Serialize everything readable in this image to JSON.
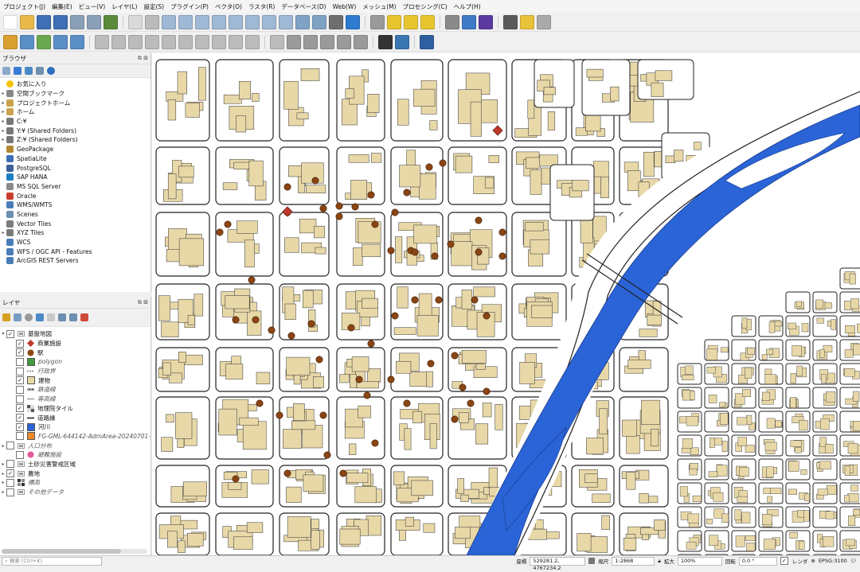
{
  "menu": [
    "プロジェクト(J)",
    "編集(E)",
    "ビュー(V)",
    "レイヤ(L)",
    "設定(S)",
    "プラグイン(P)",
    "ベクタ(O)",
    "ラスタ(R)",
    "データベース(D)",
    "Web(W)",
    "メッシュ(M)",
    "プロセシング(C)",
    "ヘルプ(H)"
  ],
  "browser": {
    "title": "ブラウザ",
    "items": [
      {
        "label": "お気に入り",
        "icon": "star-icon",
        "color": "#f5c400",
        "arrow": ""
      },
      {
        "label": "空間ブックマーク",
        "icon": "bookmark-icon",
        "color": "#888888",
        "arrow": "▸"
      },
      {
        "label": "プロジェクトホーム",
        "icon": "folder-icon",
        "color": "#c9a24c",
        "arrow": "▸"
      },
      {
        "label": "ホーム",
        "icon": "folder-icon",
        "color": "#c9a24c",
        "arrow": "▸"
      },
      {
        "label": "C:¥",
        "icon": "drive-icon",
        "color": "#777777",
        "arrow": "▸"
      },
      {
        "label": "Y:¥ (Shared Folders)",
        "icon": "drive-icon",
        "color": "#777777",
        "arrow": "▸"
      },
      {
        "label": "Z:¥ (Shared Folders)",
        "icon": "drive-icon",
        "color": "#777777",
        "arrow": "▸"
      },
      {
        "label": "GeoPackage",
        "icon": "geopackage-icon",
        "color": "#b0892f",
        "arrow": ""
      },
      {
        "label": "SpatiaLite",
        "icon": "spatialite-icon",
        "color": "#3d6fb6",
        "arrow": ""
      },
      {
        "label": "PostgreSQL",
        "icon": "postgresql-icon",
        "color": "#3b5f9a",
        "arrow": ""
      },
      {
        "label": "SAP HANA",
        "icon": "sap-hana-icon",
        "color": "#1c7fc4",
        "arrow": ""
      },
      {
        "label": "MS SQL Server",
        "icon": "mssql-icon",
        "color": "#8a8a8a",
        "arrow": ""
      },
      {
        "label": "Oracle",
        "icon": "oracle-icon",
        "color": "#c8402e",
        "arrow": ""
      },
      {
        "label": "WMS/WMTS",
        "icon": "globe-icon",
        "color": "#4a7db8",
        "arrow": ""
      },
      {
        "label": "Scenes",
        "icon": "scenes-icon",
        "color": "#6a8fb0",
        "arrow": ""
      },
      {
        "label": "Vector Tiles",
        "icon": "grid-icon",
        "color": "#7a7a7a",
        "arrow": ""
      },
      {
        "label": "XYZ Tiles",
        "icon": "grid-icon",
        "color": "#7a7a7a",
        "arrow": "▸"
      },
      {
        "label": "WCS",
        "icon": "globe-icon",
        "color": "#4a7db8",
        "arrow": ""
      },
      {
        "label": "WFS / OGC API - Features",
        "icon": "globe-icon",
        "color": "#4a7db8",
        "arrow": ""
      },
      {
        "label": "ArcGIS REST Servers",
        "icon": "globe-icon",
        "color": "#4a7db8",
        "arrow": ""
      }
    ]
  },
  "layers": {
    "title": "レイヤ",
    "items": [
      {
        "label": "基盤地図",
        "level": 0,
        "checked": true,
        "arrow": "▾",
        "icon": "group-icon",
        "symbol": "group",
        "color": "#999999",
        "italic": false
      },
      {
        "label": "商業施設",
        "level": 1,
        "checked": true,
        "arrow": "",
        "icon": "diamond-icon",
        "symbol": "diamond",
        "color": "#c0392b",
        "italic": false
      },
      {
        "label": "駅",
        "level": 1,
        "checked": true,
        "arrow": "",
        "icon": "circle-icon",
        "symbol": "circle",
        "color": "#8b4513",
        "italic": false
      },
      {
        "label": "polygon",
        "level": 1,
        "checked": false,
        "arrow": "",
        "icon": "square-icon",
        "symbol": "square",
        "color": "#3f9a3f",
        "italic": true
      },
      {
        "label": "行政界",
        "level": 1,
        "checked": false,
        "arrow": "",
        "icon": "dash-line-icon",
        "symbol": "dash",
        "color": "#555555",
        "italic": true
      },
      {
        "label": "建物",
        "level": 1,
        "checked": true,
        "arrow": "",
        "icon": "square-icon",
        "symbol": "square",
        "color": "#e8d8a8",
        "italic": false
      },
      {
        "label": "鉄道線",
        "level": 1,
        "checked": false,
        "arrow": "",
        "icon": "rail-line-icon",
        "symbol": "rail",
        "color": "#333333",
        "italic": true
      },
      {
        "label": "等高線",
        "level": 1,
        "checked": false,
        "arrow": "",
        "icon": "line-icon",
        "symbol": "line",
        "color": "#999999",
        "italic": true
      },
      {
        "label": "地理院タイル",
        "level": 1,
        "checked": true,
        "arrow": "",
        "icon": "tile-icon",
        "symbol": "tile",
        "color": "#555555",
        "italic": false
      },
      {
        "label": "道路縁",
        "level": 1,
        "checked": true,
        "arrow": "",
        "icon": "line-icon",
        "symbol": "line",
        "color": "#111111",
        "italic": false
      },
      {
        "label": "河川",
        "level": 1,
        "checked": true,
        "arrow": "",
        "icon": "square-icon",
        "symbol": "square",
        "color": "#2a64d6",
        "italic": false
      },
      {
        "label": "FG-GML-644142-AdmArea-20240701-",
        "level": 1,
        "checked": false,
        "arrow": "",
        "icon": "square-icon",
        "symbol": "square",
        "color": "#f28a2a",
        "italic": true
      },
      {
        "label": "人口分布",
        "level": 0,
        "checked": false,
        "arrow": "▸",
        "icon": "group-icon",
        "symbol": "group",
        "color": "#999999",
        "italic": true
      },
      {
        "label": "避難施設",
        "level": 1,
        "checked": false,
        "arrow": "",
        "icon": "circle-icon",
        "symbol": "circle",
        "color": "#e05a9c",
        "italic": true
      },
      {
        "label": "土砂災害警戒区域",
        "level": 0,
        "checked": false,
        "arrow": "▸",
        "icon": "group-icon",
        "symbol": "group",
        "color": "#999999",
        "italic": false
      },
      {
        "label": "農地",
        "level": 0,
        "checked": true,
        "arrow": "▸",
        "icon": "group-icon",
        "symbol": "group",
        "color": "#999999",
        "italic": false
      },
      {
        "label": "標高",
        "level": 0,
        "checked": false,
        "arrow": "▸",
        "icon": "raster-icon",
        "symbol": "raster",
        "color": "#333333",
        "italic": true
      },
      {
        "label": "その他データ",
        "level": 0,
        "checked": false,
        "arrow": "▸",
        "icon": "group-icon",
        "symbol": "group",
        "color": "#999999",
        "italic": true
      }
    ]
  },
  "colors": {
    "building": "#e8d8a8",
    "river": "#2a64d6",
    "station": "#8b4513",
    "commercial": "#c0392b"
  },
  "status": {
    "search_placeholder": "検索 (Ctrl+K)",
    "coord_label": "座標",
    "coord_value": "529281.2, 4767234.2",
    "scale_label": "縮尺",
    "scale_value": "1:2868",
    "zoom_label": "拡大",
    "zoom_value": "100%",
    "rotation_label": "回転",
    "rotation_value": "0.0 °",
    "render_label": "レンダ",
    "crs_value": "EPSG:3100"
  }
}
